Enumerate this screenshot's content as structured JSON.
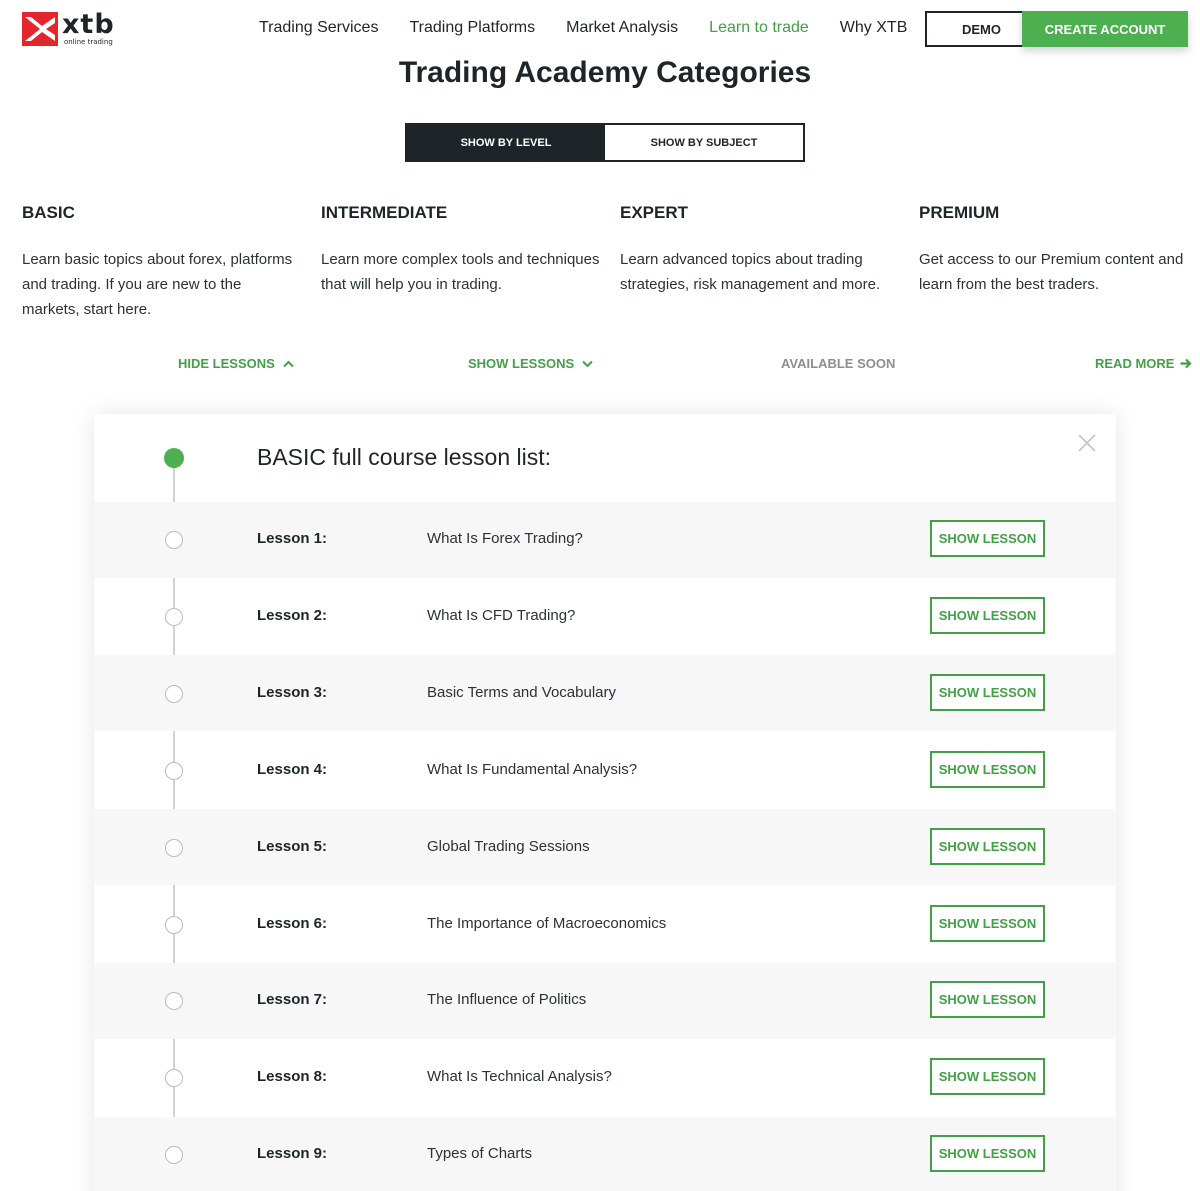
{
  "brand": {
    "name": "xtb",
    "tagline": "online trading"
  },
  "nav": {
    "items": [
      {
        "label": "Trading Services"
      },
      {
        "label": "Trading Platforms"
      },
      {
        "label": "Market Analysis"
      },
      {
        "label": "Learn to trade",
        "active": true
      },
      {
        "label": "Why XTB"
      }
    ],
    "demo_label": "DEMO",
    "create_account_label": "CREATE ACCOUNT"
  },
  "page_title": "Trading Academy Categories",
  "view_toggle": {
    "by_level": "SHOW BY LEVEL",
    "by_subject": "SHOW BY SUBJECT",
    "selected": "by_level"
  },
  "levels": [
    {
      "title": "BASIC",
      "description": "Learn basic topics about forex, platforms and trading. If you are new to the markets, start here.",
      "action": "HIDE LESSONS",
      "action_icon": "chevron-up-icon"
    },
    {
      "title": "INTERMEDIATE",
      "description": "Learn more complex tools and techniques that will help you in trading.",
      "action": "SHOW LESSONS",
      "action_icon": "chevron-down-icon"
    },
    {
      "title": "EXPERT",
      "description": "Learn advanced topics about trading strategies, risk management and more.",
      "action": "AVAILABLE SOON"
    },
    {
      "title": "PREMIUM",
      "description": "Get access to our Premium content and learn from the best traders.",
      "action": "READ MORE",
      "action_icon": "arrow-right-icon"
    }
  ],
  "lesson_panel": {
    "title": "BASIC full course lesson list:",
    "button_label": "SHOW LESSON",
    "lessons": [
      {
        "number": "Lesson 1:",
        "title": "What Is Forex Trading?"
      },
      {
        "number": "Lesson 2:",
        "title": "What Is CFD Trading?"
      },
      {
        "number": "Lesson 3:",
        "title": "Basic Terms and Vocabulary"
      },
      {
        "number": "Lesson 4:",
        "title": "What Is Fundamental Analysis?"
      },
      {
        "number": "Lesson 5:",
        "title": "Global Trading Sessions"
      },
      {
        "number": "Lesson 6:",
        "title": "The Importance of Macroeconomics"
      },
      {
        "number": "Lesson 7:",
        "title": "The Influence of Politics"
      },
      {
        "number": "Lesson 8:",
        "title": "What Is Technical Analysis?"
      },
      {
        "number": "Lesson 9:",
        "title": "Types of Charts"
      }
    ]
  },
  "colors": {
    "accent_green": "#4caf50",
    "brand_red": "#e4252c",
    "dark": "#1e2529"
  }
}
